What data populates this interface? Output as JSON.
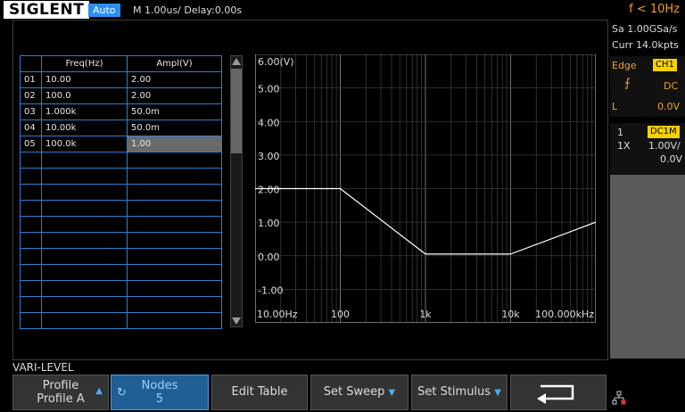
{
  "header": {
    "brand": "SIGLENT",
    "mode": "Auto",
    "timebase": "M 1.00us/  Delay:0.00s",
    "trigger_frequency": "f < 10Hz"
  },
  "table": {
    "headers": [
      "",
      "Freq(Hz)",
      "Ampl(V)"
    ],
    "rows": [
      [
        "01",
        "10.00",
        "2.00"
      ],
      [
        "02",
        "100.0",
        "2.00"
      ],
      [
        "03",
        "1.000k",
        "50.0m"
      ],
      [
        "04",
        "10.00k",
        "50.0m"
      ],
      [
        "05",
        "100.0k",
        "1.00"
      ]
    ],
    "selected_row": 4
  },
  "plot": {
    "y_ticks": [
      "6.00(V)",
      "5.00",
      "4.00",
      "3.00",
      "2.00",
      "1.00",
      "0.00",
      "-1.00"
    ],
    "x_ticks": [
      "10.00Hz",
      "100",
      "1k",
      "10k",
      "100.000kHz"
    ]
  },
  "chart_data": {
    "type": "line",
    "x": [
      10,
      100,
      1000,
      10000,
      100000
    ],
    "y": [
      2.0,
      2.0,
      0.05,
      0.05,
      1.0
    ],
    "x_scale": "log",
    "xlim": [
      10,
      100000
    ],
    "ylim": [
      -2,
      6
    ],
    "grid": true,
    "color": "#ffffff"
  },
  "right_panel": {
    "sample_rate": "Sa 1.00GSa/s",
    "memory_depth": "Curr 14.0kpts",
    "trigger_type": "Edge",
    "trigger_source": "CH1",
    "coupling": "DC",
    "level_label": "L",
    "level_value": "0.0V",
    "channel_number": "1",
    "channel_coupling": "DC1M",
    "probe": "1X",
    "volts_div": "1.00V/",
    "offset": "0.0V"
  },
  "menu": {
    "title": "VARI-LEVEL",
    "softkeys": {
      "profile_label": "Profile",
      "profile_value": "Profile A",
      "nodes_label": "Nodes",
      "nodes_value": "5",
      "edit_table": "Edit Table",
      "set_sweep": "Set Sweep",
      "set_stimulus": "Set Stimulus"
    }
  },
  "colors": {
    "accent_blue": "#2a8ff5",
    "trigger_orange": "#f0a020",
    "channel_yellow": "#f7d000",
    "table_border": "#2d7fd0"
  }
}
